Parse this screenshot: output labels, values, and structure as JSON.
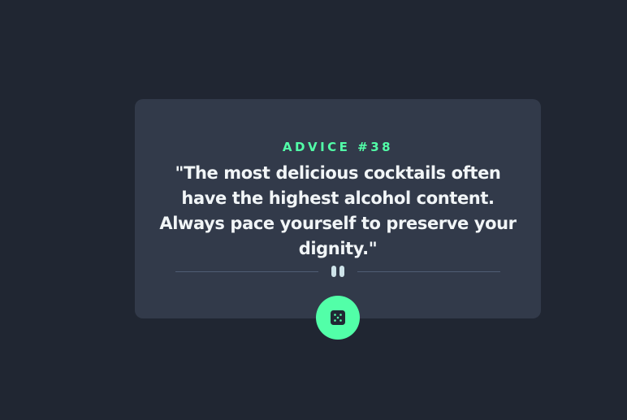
{
  "advice": {
    "id_label": "ADVICE #38",
    "quote": "\"The most delicious cocktails often have the highest alcohol content. Always pace yourself to preserve your dignity.\""
  },
  "icons": {
    "divider": "pause-icon",
    "button": "dice-icon"
  },
  "colors": {
    "background": "#202632",
    "card": "#323a4a",
    "accent": "#52ffa8",
    "text": "#f1f5f7",
    "divider": "#4f5d74"
  }
}
